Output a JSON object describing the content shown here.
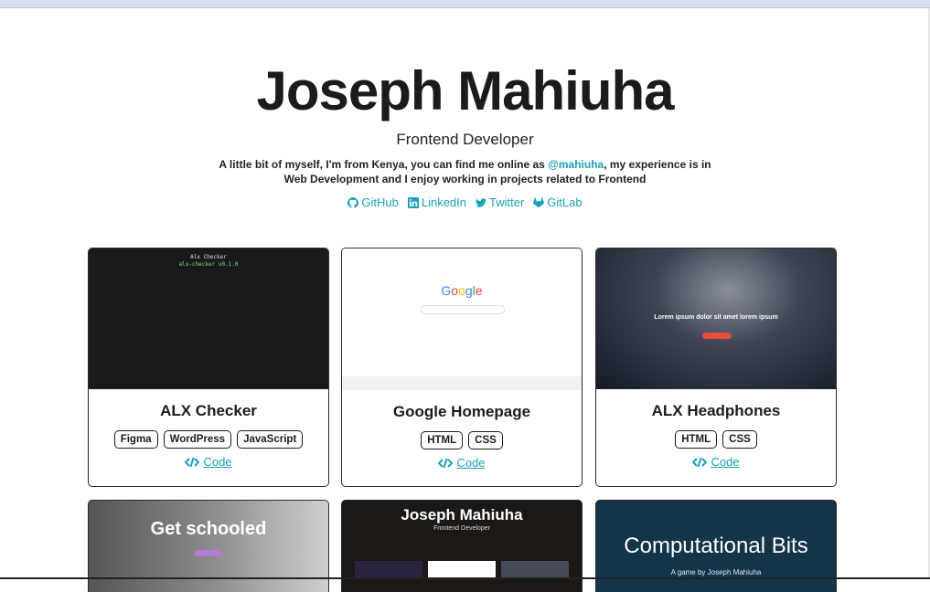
{
  "header": {
    "name": "Joseph Mahiuha",
    "role": "Frontend Developer",
    "bio_before": "A little bit of myself, I'm from Kenya, you can find me online as ",
    "handle": "@mahiuha",
    "bio_after": ", my experience is in Web Development and I enjoy working in projects related to Frontend"
  },
  "social": [
    {
      "label": "GitHub",
      "icon": "github-icon"
    },
    {
      "label": "LinkedIn",
      "icon": "linkedin-icon"
    },
    {
      "label": "Twitter",
      "icon": "twitter-icon"
    },
    {
      "label": "GitLab",
      "icon": "gitlab-icon"
    }
  ],
  "projects": [
    {
      "title": "ALX Checker",
      "tags": [
        "Figma",
        "WordPress",
        "JavaScript"
      ],
      "code_label": "Code",
      "preview": {
        "line1": "Alx Checker",
        "line2": "alx-checker v0.1.0"
      }
    },
    {
      "title": "Google Homepage",
      "tags": [
        "HTML",
        "CSS"
      ],
      "code_label": "Code",
      "preview": {
        "logo": "Google"
      }
    },
    {
      "title": "ALX Headphones",
      "tags": [
        "HTML",
        "CSS"
      ],
      "code_label": "Code",
      "preview": {
        "headline": "Lorem ipsum dolor sit amet lorem ipsum"
      }
    }
  ],
  "projects_row2": [
    {
      "preview_text": "Get schooled"
    },
    {
      "preview_text": "Joseph Mahiuha",
      "preview_sub": "Frontend Developer"
    },
    {
      "preview_text": "Computational Bits",
      "preview_sub": "A game by Joseph Mahiuha"
    }
  ],
  "colors": {
    "accent": "#1aa1b8",
    "text": "#1e1e1e",
    "border": "#2b2b2b"
  }
}
